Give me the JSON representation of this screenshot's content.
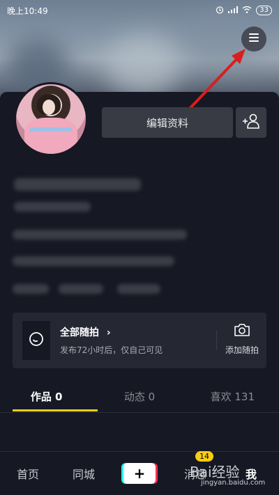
{
  "status_bar": {
    "time": "晚上10:49",
    "battery": "33"
  },
  "profile": {
    "edit_button_label": "编辑资料"
  },
  "story": {
    "title": "全部随拍",
    "chevron": "›",
    "subtitle": "发布72小时后，仅自己可见",
    "add_label": "添加随拍"
  },
  "tabs": [
    {
      "label": "作品 0",
      "active": true
    },
    {
      "label": "动态 0",
      "active": false
    },
    {
      "label": "喜欢 131",
      "active": false
    }
  ],
  "bottom_nav": {
    "home": "首页",
    "nearby": "同城",
    "plus": "+",
    "messages": "消息",
    "messages_badge": "14",
    "me": "我"
  },
  "watermark": {
    "brand": "Bai经验",
    "url": "jingyan.baidu.com"
  },
  "colors": {
    "background": "#161823",
    "accent": "#facc15",
    "arrow": "#d81e1e"
  },
  "icons": [
    "hamburger-menu-icon",
    "add-friend-icon",
    "story-circle-icon",
    "camera-icon",
    "alarm-icon",
    "signal-icon",
    "wifi-icon"
  ]
}
